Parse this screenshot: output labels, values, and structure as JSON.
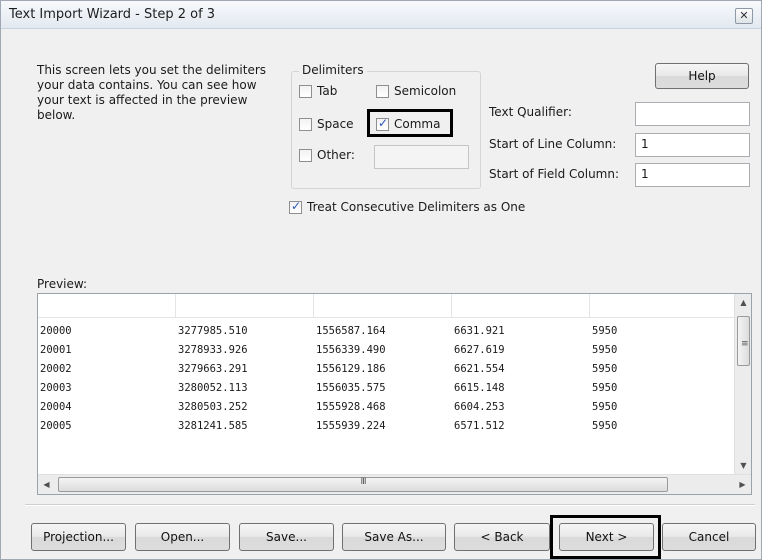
{
  "window": {
    "title": "Text Import Wizard - Step 2 of 3",
    "close_glyph": "✕"
  },
  "intro": "This screen lets you set the delimiters\nyour data contains.  You can see how\nyour text is affected in the preview\nbelow.",
  "delimiters": {
    "legend": "Delimiters",
    "tab": {
      "label": "Tab",
      "checked": false
    },
    "semicolon": {
      "label": "Semicolon",
      "checked": false
    },
    "space": {
      "label": "Space",
      "checked": false
    },
    "comma": {
      "label": "Comma",
      "checked": true
    },
    "other": {
      "label": "Other:",
      "checked": false,
      "value": ""
    }
  },
  "treat_consecutive": {
    "label": "Treat Consecutive Delimiters as One",
    "checked": true
  },
  "help_label": "Help",
  "text_qualifier": {
    "label": "Text Qualifier:",
    "value": ""
  },
  "start_line": {
    "label": "Start of Line Column:",
    "value": "1"
  },
  "start_field": {
    "label": "Start of Field Column:",
    "value": "1"
  },
  "preview": {
    "label": "Preview:",
    "rows": [
      [
        "20000",
        "3277985.510",
        "1556587.164",
        "6631.921",
        "5950"
      ],
      [
        "20001",
        "3278933.926",
        "1556339.490",
        "6627.619",
        "5950"
      ],
      [
        "20002",
        "3279663.291",
        "1556129.186",
        "6621.554",
        "5950"
      ],
      [
        "20003",
        "3280052.113",
        "1556035.575",
        "6615.148",
        "5950"
      ],
      [
        "20004",
        "3280503.252",
        "1555928.468",
        "6604.253",
        "5950"
      ],
      [
        "20005",
        "3281241.585",
        "1555939.224",
        "6571.512",
        "5950"
      ]
    ]
  },
  "buttons": {
    "projection": "Projection...",
    "open": "Open...",
    "save": "Save...",
    "save_as": "Save As...",
    "back": "< Back",
    "next": "Next >",
    "cancel": "Cancel"
  },
  "icons": {
    "scroll_up": "▲",
    "scroll_down": "▼",
    "scroll_left": "◀",
    "scroll_right": "▶",
    "v_grip": "≡",
    "h_grip": "III"
  }
}
